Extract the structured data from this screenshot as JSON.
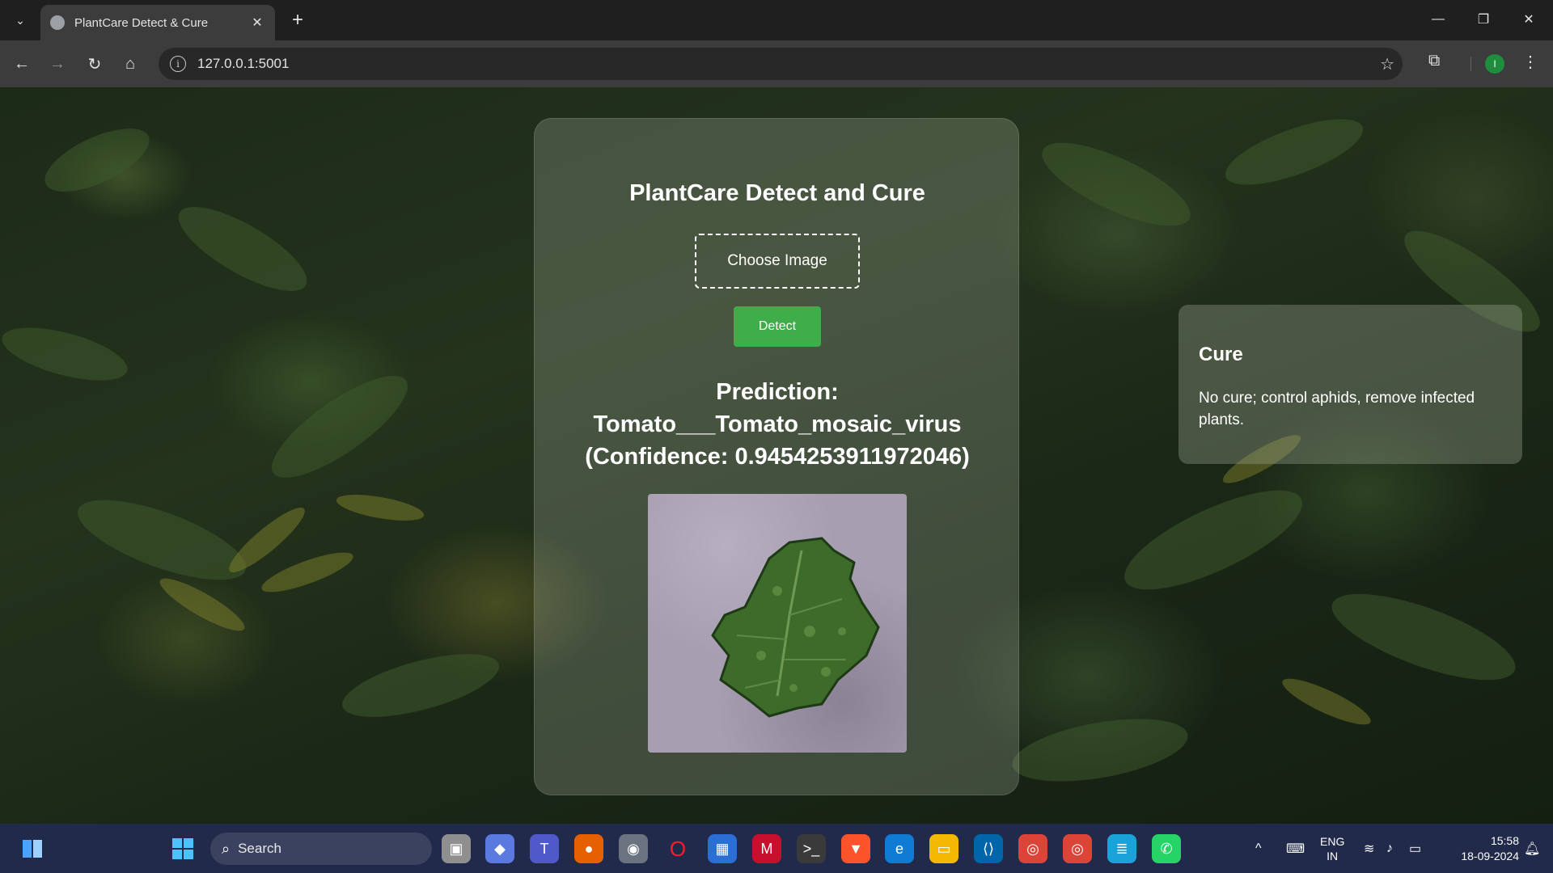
{
  "browser": {
    "tab_title": "PlantCare Detect & Cure",
    "url": "127.0.0.1:5001",
    "profile_initial": "I"
  },
  "page": {
    "title": "PlantCare Detect and Cure",
    "choose_label": "Choose Image",
    "detect_label": "Detect",
    "prediction_label": "Prediction:",
    "prediction_class": "Tomato___Tomato_mosaic_virus",
    "confidence_text": "(Confidence: 0.9454253911972046)",
    "cure_title": "Cure",
    "cure_text": "No cure; control aphids, remove infected plants."
  },
  "taskbar": {
    "search_label": "Search",
    "lang_line1": "ENG",
    "lang_line2": "IN",
    "time": "15:58",
    "date": "18-09-2024"
  },
  "colors": {
    "detect_button": "#3fae4a",
    "taskbar": "#212a4a",
    "browser_chrome": "#3c3c3c"
  }
}
